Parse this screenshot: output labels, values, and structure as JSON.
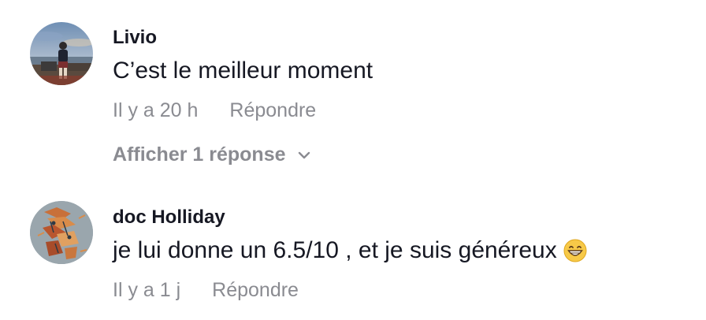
{
  "comments": [
    {
      "username": "Livio",
      "text": "C’est le meilleur moment",
      "timestamp": "Il y a 20 h",
      "reply_label": "Répondre",
      "view_replies_label": "Afficher 1 réponse",
      "avatar_icon": "person-photo-avatar"
    },
    {
      "username": "doc Holliday",
      "text": "je lui donne un 6.5/10 , et je suis généreux",
      "emoji": "grinning-face-emoji",
      "timestamp": "Il y a 1 j",
      "reply_label": "Répondre",
      "avatar_icon": "artwork-avatar"
    }
  ],
  "colors": {
    "primary_text": "#161823",
    "secondary_text": "#8a8b91",
    "background": "#ffffff"
  }
}
